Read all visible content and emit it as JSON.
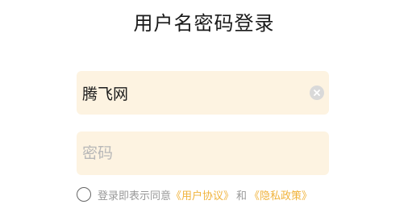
{
  "page": {
    "title": "用户名密码登录"
  },
  "form": {
    "username": {
      "value": "腾飞网",
      "placeholder": ""
    },
    "password": {
      "value": "",
      "placeholder": "密码"
    }
  },
  "agreement": {
    "prefix": "登录即表示同意",
    "user_agreement_link": "《用户协议》",
    "conjunction": "和",
    "privacy_policy_link": "《隐私政策》",
    "checked": false
  },
  "colors": {
    "field_background": "#fdf3e1",
    "link": "#f0b33c",
    "clear_icon": "#d9d9d9"
  }
}
